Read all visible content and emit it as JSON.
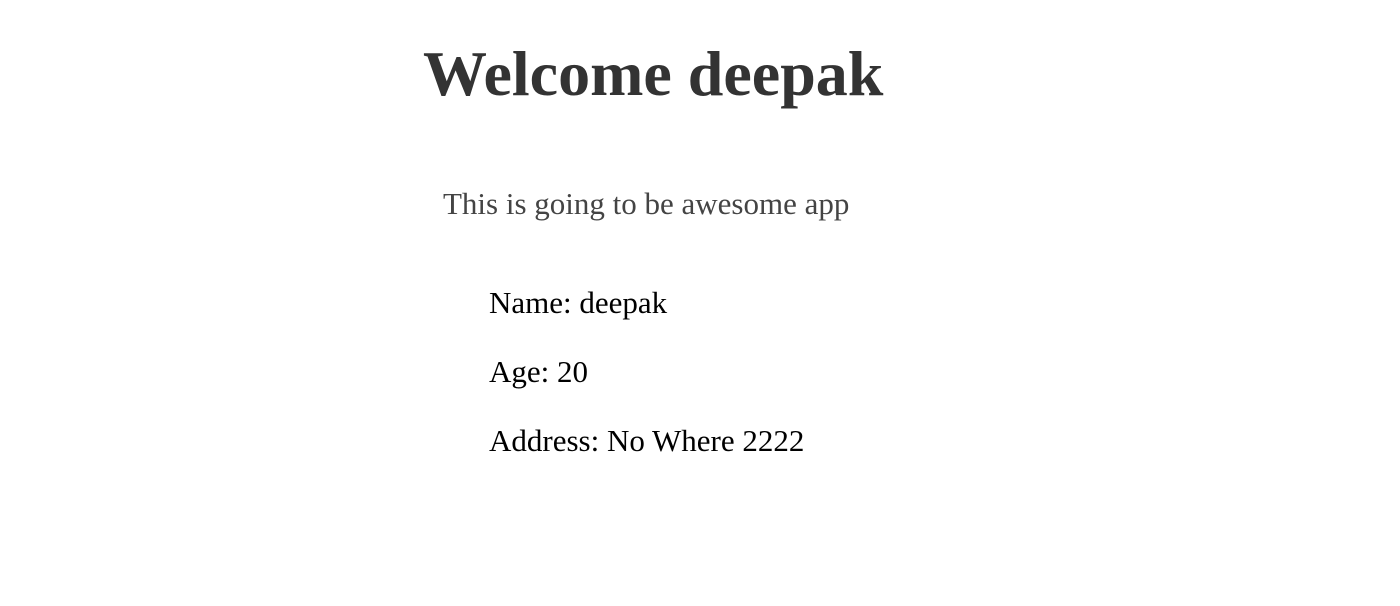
{
  "header": {
    "title": "Welcome deepak"
  },
  "main": {
    "tagline": "This is going to be awesome app",
    "details": {
      "name": "Name: deepak",
      "age": "Age: 20",
      "address": "Address: No Where 2222"
    }
  }
}
